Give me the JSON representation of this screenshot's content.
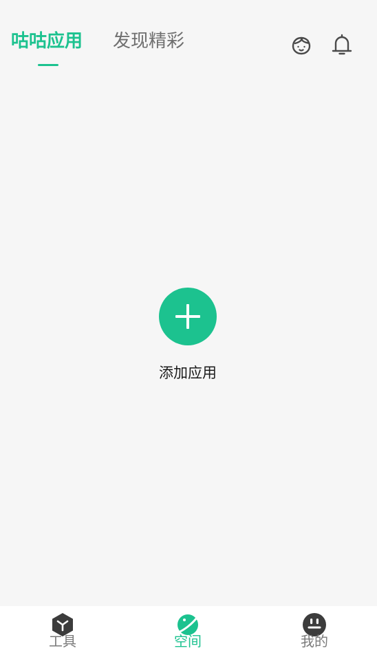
{
  "header": {
    "tabs": [
      {
        "label": "咕咕应用",
        "active": true
      },
      {
        "label": "发现精彩",
        "active": false
      }
    ],
    "icons": [
      "face-icon",
      "bell-icon"
    ]
  },
  "main": {
    "add_label": "添加应用"
  },
  "bottom_nav": {
    "items": [
      {
        "label": "工具",
        "icon": "cube-icon",
        "active": false
      },
      {
        "label": "空间",
        "icon": "planet-icon",
        "active": true
      },
      {
        "label": "我的",
        "icon": "smiley-icon",
        "active": false
      }
    ]
  },
  "colors": {
    "accent": "#1cc28f",
    "background": "#f6f6f6",
    "inactive_text": "#6f6f6f",
    "nav_background": "#ffffff"
  }
}
